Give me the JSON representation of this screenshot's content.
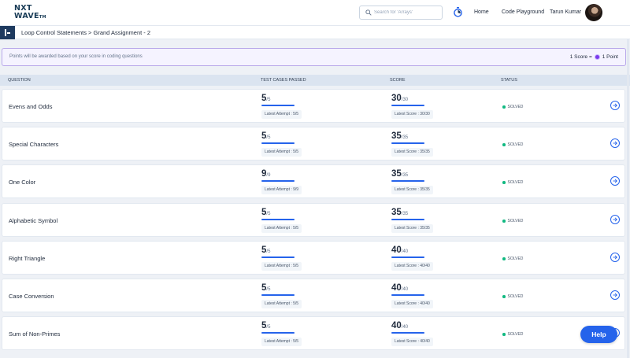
{
  "header": {
    "logo_line1": "NXT",
    "logo_line2": "WAVE",
    "logo_tm": "TM",
    "search_placeholder": "Search for 'Arrays'",
    "nav_home": "Home",
    "nav_playground": "Code Playground",
    "user_name": "Tarun Kumar"
  },
  "breadcrumb": "Loop Control Statements > Grand Assignment - 2",
  "notice": {
    "text": "Points will be awarded based on your score in coding questions",
    "rule_left": "1 Score =",
    "rule_right": "1 Point"
  },
  "table": {
    "headers": {
      "question": "QUESTION",
      "tests": "TEST CASES PASSED",
      "score": "SCORE",
      "status": "STATUS"
    },
    "rows": [
      {
        "question": "Evens and Odds",
        "tests_passed": "5",
        "tests_total": "/5",
        "tests_fraction": 1,
        "latest_attempt": "Latest Attempt : 5/5",
        "score": "30",
        "score_total": "/30",
        "score_fraction": 1,
        "latest_score": "Latest Score : 30/30",
        "status": "SOLVED"
      },
      {
        "question": "Special Characters",
        "tests_passed": "5",
        "tests_total": "/5",
        "tests_fraction": 1,
        "latest_attempt": "Latest Attempt : 5/5",
        "score": "35",
        "score_total": "/35",
        "score_fraction": 1,
        "latest_score": "Latest Score : 35/35",
        "status": "SOLVED"
      },
      {
        "question": "One Color",
        "tests_passed": "9",
        "tests_total": "/9",
        "tests_fraction": 1,
        "latest_attempt": "Latest Attempt : 9/9",
        "score": "35",
        "score_total": "/35",
        "score_fraction": 1,
        "latest_score": "Latest Score : 35/35",
        "status": "SOLVED"
      },
      {
        "question": "Alphabetic Symbol",
        "tests_passed": "5",
        "tests_total": "/5",
        "tests_fraction": 1,
        "latest_attempt": "Latest Attempt : 5/5",
        "score": "35",
        "score_total": "/35",
        "score_fraction": 1,
        "latest_score": "Latest Score : 35/35",
        "status": "SOLVED"
      },
      {
        "question": "Right Triangle",
        "tests_passed": "5",
        "tests_total": "/5",
        "tests_fraction": 1,
        "latest_attempt": "Latest Attempt : 5/5",
        "score": "40",
        "score_total": "/40",
        "score_fraction": 1,
        "latest_score": "Latest Score : 40/40",
        "status": "SOLVED"
      },
      {
        "question": "Case Conversion",
        "tests_passed": "5",
        "tests_total": "/5",
        "tests_fraction": 1,
        "latest_attempt": "Latest Attempt : 5/5",
        "score": "40",
        "score_total": "/40",
        "score_fraction": 1,
        "latest_score": "Latest Score : 40/40",
        "status": "SOLVED"
      },
      {
        "question": "Sum of Non-Primes",
        "tests_passed": "5",
        "tests_total": "/5",
        "tests_fraction": 1,
        "latest_attempt": "Latest Attempt : 5/5",
        "score": "40",
        "score_total": "/40",
        "score_fraction": 1,
        "latest_score": "Latest Score : 40/40",
        "status": "SOLVED"
      }
    ]
  },
  "help_label": "Help",
  "colors": {
    "accent": "#2563eb",
    "navy": "#1e3a5f",
    "solved": "#10b981",
    "notice_border": "#b8a8ea"
  }
}
